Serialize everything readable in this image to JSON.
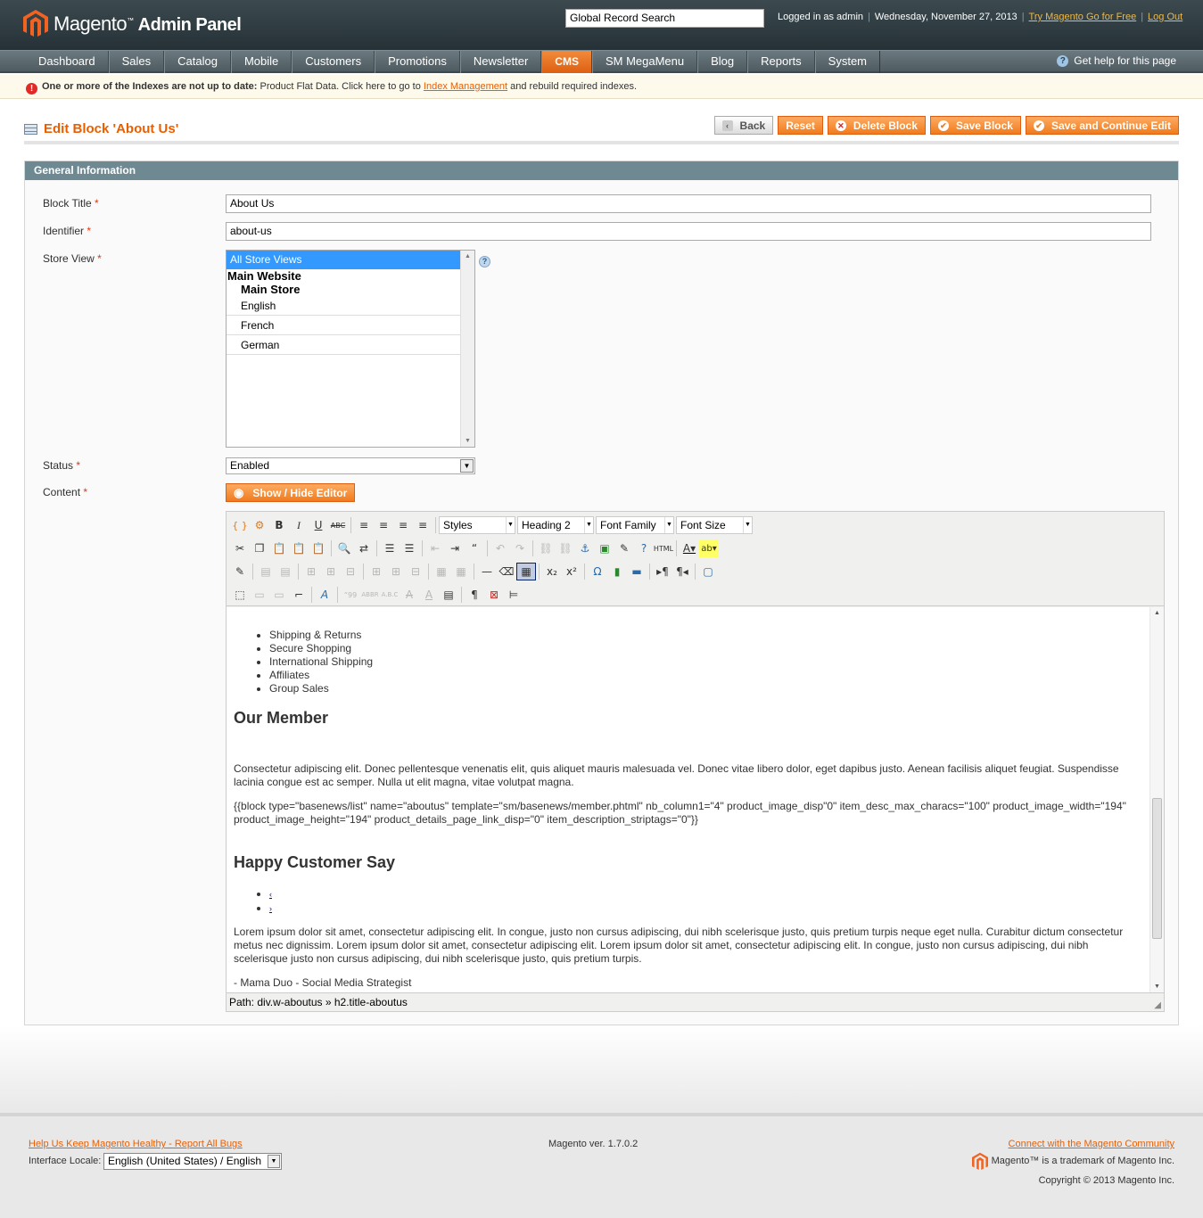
{
  "header": {
    "logo_text": "Magento",
    "logo_sub": "Admin Panel",
    "search_value": "Global Record Search",
    "logged_in": "Logged in as admin",
    "date": "Wednesday, November 27, 2013",
    "try_link": "Try Magento Go for Free",
    "logout": "Log Out"
  },
  "nav": {
    "items": [
      "Dashboard",
      "Sales",
      "Catalog",
      "Mobile",
      "Customers",
      "Promotions",
      "Newsletter",
      "CMS",
      "SM MegaMenu",
      "Blog",
      "Reports",
      "System"
    ],
    "active": "CMS",
    "help": "Get help for this page"
  },
  "notice": {
    "bold": "One or more of the Indexes are not up to date:",
    "text": " Product Flat Data. Click here to go to ",
    "link": "Index Management",
    "tail": " and rebuild required indexes."
  },
  "page": {
    "title": "Edit Block 'About Us'",
    "buttons": {
      "back": "Back",
      "reset": "Reset",
      "delete": "Delete Block",
      "save": "Save Block",
      "save_continue": "Save and Continue Edit"
    }
  },
  "section": {
    "title": "General Information",
    "fields": {
      "block_title_label": "Block Title",
      "block_title_value": "About Us",
      "identifier_label": "Identifier",
      "identifier_value": "about-us",
      "store_view_label": "Store View",
      "store_options": {
        "all": "All Store Views",
        "website": "Main Website",
        "store": "Main Store",
        "views": [
          "English",
          "French",
          "German"
        ]
      },
      "status_label": "Status",
      "status_value": "Enabled",
      "content_label": "Content",
      "show_hide": "Show / Hide Editor"
    }
  },
  "editor": {
    "styles": "Styles",
    "format": "Heading 2",
    "font_family": "Font Family",
    "font_size": "Font Size",
    "list": [
      "Shipping & Returns",
      "Secure Shopping",
      "International Shipping",
      "Affiliates",
      "Group Sales"
    ],
    "h_member": "Our Member",
    "p_member": "Consectetur adipiscing elit. Donec pellentesque venenatis elit, quis aliquet mauris malesuada vel. Donec vitae libero dolor, eget dapibus justo. Aenean facilisis aliquet feugiat. Suspendisse lacinia congue est ac semper. Nulla ut elit magna, vitae volutpat magna.",
    "block_code": "{{block type=\"basenews/list\" name=\"aboutus\" template=\"sm/basenews/member.phtml\" nb_column1=\"4\" product_image_disp\"0\" item_desc_max_characs=\"100\" product_image_width=\"194\" product_image_height=\"194\" product_details_page_link_disp=\"0\" item_description_striptags=\"0\"}}",
    "h_happy": "Happy Customer Say",
    "nav_links": [
      "‹",
      "›"
    ],
    "p_lorem": "Lorem ipsum dolor sit amet, consectetur adipiscing elit. In congue, justo non cursus adipiscing, dui nibh scelerisque justo, quis pretium turpis neque eget nulla. Curabitur dictum consectetur metus nec dignissim. Lorem ipsum dolor sit amet, consectetur adipiscing elit. Lorem ipsum dolor sit amet, consectetur adipiscing elit. In congue, justo non cursus adipiscing, dui nibh scelerisque justo non cursus adipiscing, dui nibh scelerisque justo, quis pretium turpis.",
    "author": "- Mama Duo - Social Media Strategist",
    "path": "Path: div.w-aboutus » h2.title-aboutus"
  },
  "footer": {
    "report_link": "Help Us Keep Magento Healthy - Report All Bugs",
    "locale_label": "Interface Locale:",
    "locale_value": "English (United States) / English",
    "version": "Magento ver. 1.7.0.2",
    "community": "Connect with the Magento Community",
    "trademark": "Magento™ is a trademark of Magento Inc.",
    "copyright": "Copyright © 2013 Magento Inc."
  },
  "colors": {
    "accent": "#eb5e00",
    "header": "#2c393e",
    "section_head": "#6f8992"
  }
}
